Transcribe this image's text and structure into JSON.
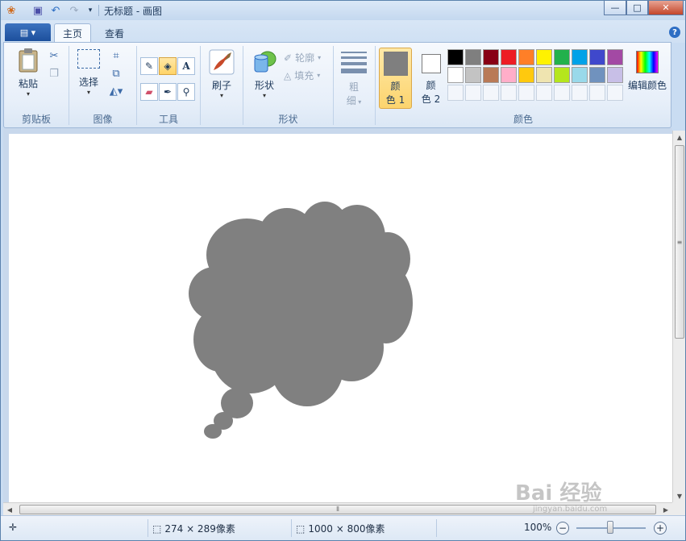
{
  "window": {
    "title": "无标题 - 画图",
    "controls": {
      "minimize": "—",
      "maximize": "□",
      "close": "✕"
    }
  },
  "quick_access": {
    "icons": [
      "paint-app-icon",
      "save-icon",
      "undo-icon",
      "redo-icon",
      "customize-dropdown-icon"
    ]
  },
  "tabs": [
    {
      "label": "主页",
      "active": true
    },
    {
      "label": "查看",
      "active": false
    }
  ],
  "app_menu": {
    "symbol": "▤ ▾"
  },
  "help": {
    "label": "?"
  },
  "ribbon": {
    "clipboard": {
      "group_label": "剪贴板",
      "paste_label": "粘贴"
    },
    "image": {
      "group_label": "图像",
      "select_label": "选择"
    },
    "tools": {
      "group_label": "工具"
    },
    "brushes": {
      "label": "刷子"
    },
    "shapes": {
      "group_label": "形状",
      "shapes_label": "形状",
      "outline_label": "轮廓",
      "fill_label": "填充"
    },
    "size": {
      "label_line1": "粗",
      "label_line2": "细"
    },
    "colors": {
      "group_label": "颜色",
      "color1_line1": "颜",
      "color1_line2": "色 1",
      "color2_line1": "颜",
      "color2_line2": "色 2",
      "color1_value": "#7f7f7f",
      "color2_value": "#ffffff",
      "edit_label": "编辑颜色",
      "palette_row1": [
        "#000000",
        "#7f7f7f",
        "#880015",
        "#ed1c24",
        "#ff7f27",
        "#fff200",
        "#22b14c",
        "#00a2e8",
        "#3f48cc",
        "#a349a4"
      ],
      "palette_row2": [
        "#ffffff",
        "#c3c3c3",
        "#b97a57",
        "#ffaec9",
        "#ffc90e",
        "#efe4b0",
        "#b5e61d",
        "#99d9ea",
        "#7092be",
        "#c8bfe7"
      ],
      "palette_row3_count": 10
    }
  },
  "canvas": {
    "shape_color": "#808080",
    "shape": "thought-bubble"
  },
  "status": {
    "selection_size": "274 × 289像素",
    "canvas_size": "1000 × 800像素",
    "zoom": "100%"
  },
  "watermark": {
    "text": "Bai 经验",
    "sub": "jingyan.baidu.com"
  }
}
